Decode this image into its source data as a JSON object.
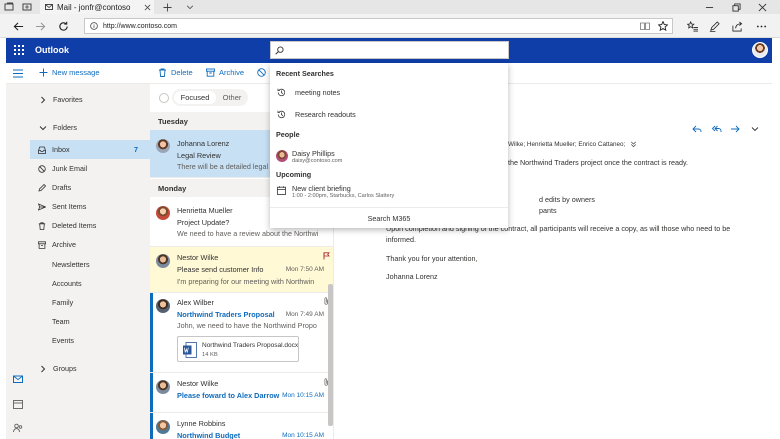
{
  "browser": {
    "tab_title": "Mail - jonfr@contoso",
    "url": "http://www.contoso.com"
  },
  "app": {
    "brand": "Outlook",
    "search_placeholder": "",
    "accent": "#0f3ea8"
  },
  "commands": {
    "new_message": "New message",
    "delete": "Delete",
    "archive": "Archive"
  },
  "folders": {
    "favorites": "Favorites",
    "folders": "Folders",
    "inbox": "Inbox",
    "inbox_count": "7",
    "junk": "Junk Email",
    "drafts": "Drafts",
    "sent": "Sent Items",
    "deleted": "Deleted Items",
    "archive": "Archive",
    "newsletters": "Newsletters",
    "accounts": "Accounts",
    "family": "Family",
    "team": "Team",
    "events": "Events",
    "groups": "Groups"
  },
  "list": {
    "focused": "Focused",
    "other": "Other",
    "day_tuesday": "Tuesday",
    "day_monday": "Monday",
    "messages": [
      {
        "sender": "Johanna Lorenz",
        "subject": "Legal Review",
        "preview": "There will be a detailed legal rev",
        "time": ""
      },
      {
        "sender": "Henrietta Mueller",
        "subject": "Project Update?",
        "preview": "We need to have a review about the Northwi",
        "time": ""
      },
      {
        "sender": "Nestor Wilke",
        "subject": "Please send customer Info",
        "preview": "I'm preparing for our meeting with Northwin",
        "time": "Mon 7:50 AM"
      },
      {
        "sender": "Alex Wilber",
        "subject": "Northwind Traders Proposal",
        "preview": "John, we need to have the Northwind Propo",
        "time": "Mon 7:49 AM",
        "attachment_name": "Northwind Traders Proposal.docx",
        "attachment_size": "14 KB"
      },
      {
        "sender": "Nestor Wilke",
        "subject": "Please foward to Alex Darrow",
        "preview": "",
        "time": "Mon 10:15 AM"
      },
      {
        "sender": "Lynne Robbins",
        "subject": "Northwind Budget",
        "preview": "",
        "time": "Mon 10:15 AM"
      }
    ]
  },
  "reading": {
    "recipients": "Wilke; Henrietta Mueller; Enrico Cattaneo;",
    "line1": "the Northwind Traders project once the contract is ready.",
    "line2": "d edits by owners",
    "line3": "pants",
    "line4": "Upon completion and signing of the contract, all participants will receive a copy, as will those who need to be",
    "line5": "informed.",
    "line6": "Thank you for your attention,",
    "line7": "Johanna Lorenz"
  },
  "dropdown": {
    "recent_heading": "Recent Searches",
    "recent_1": "meeting notes",
    "recent_2": "Research readouts",
    "people_heading": "People",
    "person_name": "Daisy Phillips",
    "person_email": "daisy@contoso.com",
    "upcoming_heading": "Upcoming",
    "event_title": "New client briefing",
    "event_detail": "1:00 - 2:00pm, Starbucks, Carlos Slattery",
    "footer": "Search M365"
  }
}
